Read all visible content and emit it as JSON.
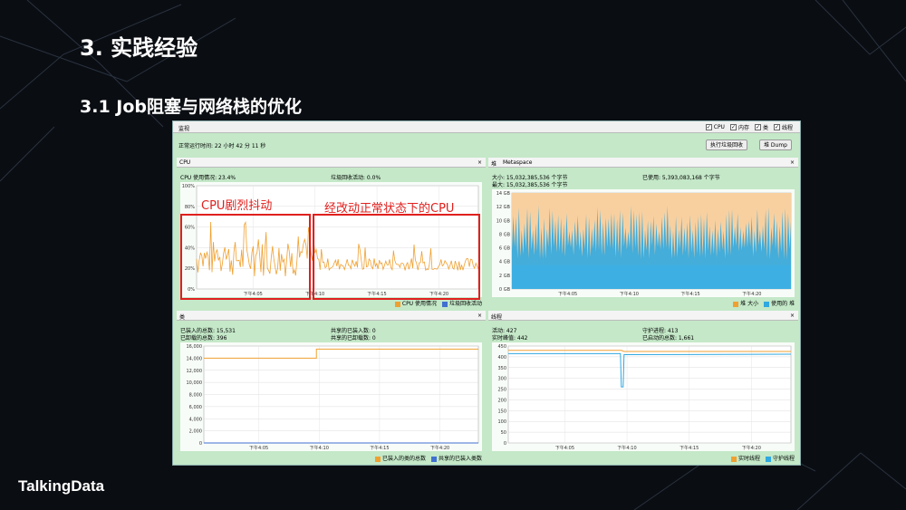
{
  "slide": {
    "title": "3. 实践经验",
    "subtitle": "3.1 Job阻塞与网络栈的优化",
    "logo": "TalkingData"
  },
  "app": {
    "tab": "监视",
    "checkboxes": [
      {
        "label": "CPU",
        "checked": true
      },
      {
        "label": "内存",
        "checked": true
      },
      {
        "label": "类",
        "checked": true
      },
      {
        "label": "线程",
        "checked": true
      }
    ],
    "uptime": "正常运行时间: 22 小时 42 分 11 秒",
    "gc_button": "执行垃圾回收",
    "dump_button": "堆 Dump"
  },
  "cpu": {
    "tab": "CPU",
    "usage": "CPU 使用情况: 23.4%",
    "gc": "垃圾回收活动: 0.0%",
    "legend": [
      "CPU 使用情况",
      "垃圾回收活动"
    ],
    "colors": [
      "#f0a030",
      "#4070d0"
    ],
    "y_ticks": [
      "100%",
      "80%",
      "60%",
      "40%",
      "20%",
      "0%"
    ],
    "x_ticks": [
      "下午4:05",
      "下午4:10",
      "下午4:15",
      "下午4:20"
    ],
    "ann_left": "CPU剧烈抖动",
    "ann_right": "经改动正常状态下的CPU"
  },
  "heap": {
    "tab1": "堆",
    "tab2": "Metaspace",
    "size": "大小: 15,032,385,536 个字节",
    "used": "已使用: 5,393,083,168 个字节",
    "max": "最大: 15,032,385,536 个字节",
    "y_ticks": [
      "14 GB",
      "12 GB",
      "10 GB",
      "8 GB",
      "6 GB",
      "4 GB",
      "2 GB",
      "0 GB"
    ],
    "x_ticks": [
      "下午4:05",
      "下午4:10",
      "下午4:15",
      "下午4:20"
    ],
    "legend": [
      "堆 大小",
      "使用的 堆"
    ],
    "colors": [
      "#f0a030",
      "#30a8e0"
    ]
  },
  "classes": {
    "tab": "类",
    "loaded": "已装入的总数: 15,531",
    "unloaded": "已卸载的总数: 396",
    "shared_loaded": "共享的已装入数: 0",
    "shared_unloaded": "共享的已卸载数: 0",
    "y_ticks": [
      "16,000",
      "14,000",
      "12,000",
      "10,000",
      "8,000",
      "6,000",
      "4,000",
      "2,000",
      "0"
    ],
    "x_ticks": [
      "下午4:05",
      "下午4:10",
      "下午4:15",
      "下午4:20"
    ],
    "legend": [
      "已装入的类的总数",
      "共享的已装入类数"
    ],
    "colors": [
      "#f0a030",
      "#4070d0"
    ]
  },
  "threads": {
    "tab": "线程",
    "live": "活动: 427",
    "peak": "实时峰值: 442",
    "daemon": "守护进程: 413",
    "started": "已启动的总数: 1,661",
    "y_ticks": [
      "450",
      "400",
      "350",
      "300",
      "250",
      "200",
      "150",
      "100",
      "50",
      "0"
    ],
    "x_ticks": [
      "下午4:05",
      "下午4:10",
      "下午4:15",
      "下午4:20"
    ],
    "legend": [
      "实时线程",
      "守护线程"
    ],
    "colors": [
      "#f0a030",
      "#30a8e0"
    ]
  }
}
